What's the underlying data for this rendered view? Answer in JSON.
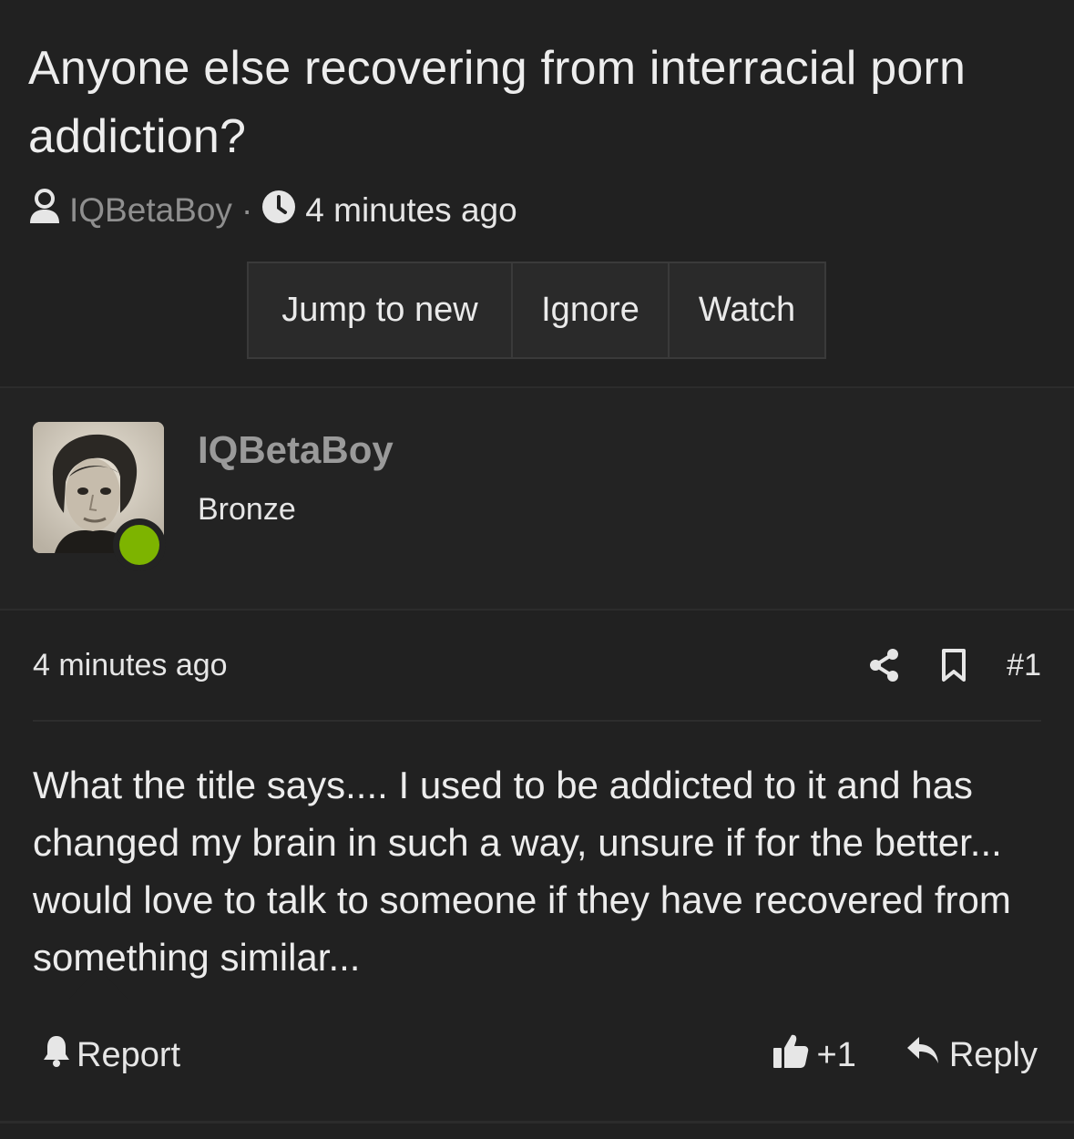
{
  "thread": {
    "title": "Anyone else recovering from interracial porn addiction?",
    "author": "IQBetaBoy",
    "separator": "·",
    "time": "4 minutes ago",
    "buttons": {
      "jump_to_new": "Jump to new",
      "ignore": "Ignore",
      "watch": "Watch"
    }
  },
  "post": {
    "username": "IQBetaBoy",
    "rank": "Bronze",
    "online": true,
    "online_color": "#7db400",
    "time": "4 minutes ago",
    "number": "#1",
    "body": "What the title says.... I used to be addicted to it and has changed my brain in such a way, unsure if for the better... would love to talk to someone if they have recovered from something similar...",
    "footer": {
      "report_label": "Report",
      "reaction_count": "+1",
      "reply_label": "Reply"
    },
    "icons": {
      "share": "share-icon",
      "bookmark": "bookmark-icon",
      "report": "bell-icon",
      "reaction": "thumbs-up-icon",
      "reply": "reply-arrow-icon"
    }
  },
  "colors": {
    "background": "#212121",
    "muted_text": "#8f8f8f"
  }
}
